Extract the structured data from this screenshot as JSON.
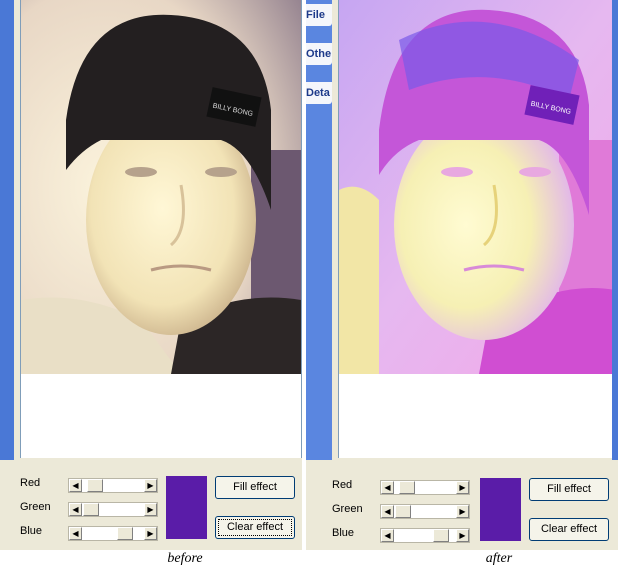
{
  "before": {
    "caption": "before",
    "controls": {
      "red_label": "Red",
      "green_label": "Green",
      "blue_label": "Blue",
      "red_value": 0.3,
      "green_value": 0.25,
      "blue_value": 0.45,
      "swatch_color": "#5a1ca8",
      "fill_effect_label": "Fill effect",
      "clear_effect_label": "Clear effect"
    }
  },
  "after": {
    "caption": "after",
    "tabs": [
      "File",
      "Othe",
      "Deta"
    ],
    "controls": {
      "red_label": "Red",
      "green_label": "Green",
      "blue_label": "Blue",
      "red_value": 0.3,
      "green_value": 0.12,
      "blue_value": 0.55,
      "swatch_color": "#5a1ca8",
      "fill_effect_label": "Fill effect",
      "clear_effect_label": "Clear effect"
    }
  },
  "colors": {
    "accent_blue": "#4a78d6",
    "dialog_bg": "#ece9d8"
  }
}
